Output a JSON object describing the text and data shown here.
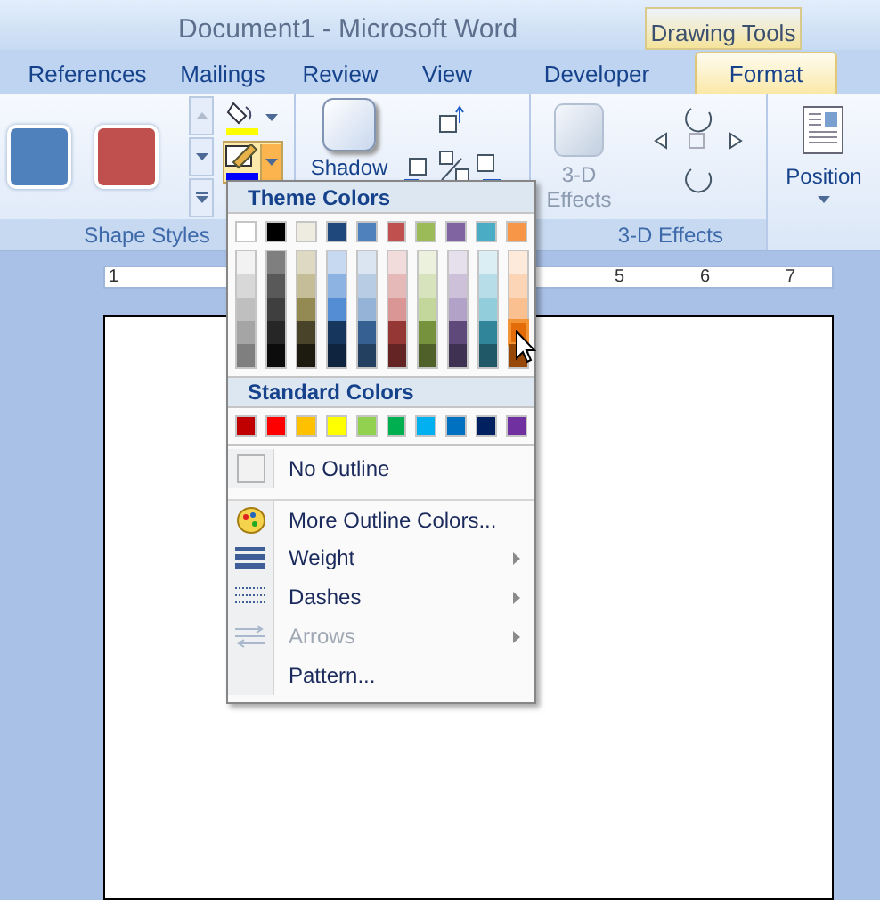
{
  "window": {
    "title": "Document1 - Microsoft Word",
    "contextual_tab": "Drawing Tools"
  },
  "tabs": [
    {
      "label": "References",
      "selected": false
    },
    {
      "label": "Mailings",
      "selected": false
    },
    {
      "label": "Review",
      "selected": false
    },
    {
      "label": "View",
      "selected": false
    },
    {
      "label": "Developer",
      "selected": false
    },
    {
      "label": "Format",
      "selected": true
    }
  ],
  "ribbon": {
    "shape_styles": {
      "label": "Shape Styles",
      "swatches": [
        {
          "color": "#4f81bd"
        },
        {
          "color": "#c0504d"
        }
      ]
    },
    "shadow": {
      "button": "Shadow"
    },
    "three_d": {
      "button": "3-D Effects",
      "label": "3-D Effects"
    },
    "position": {
      "button": "Position"
    }
  },
  "ruler": {
    "numbers": [
      "1",
      "5",
      "6",
      "7"
    ]
  },
  "outline_menu": {
    "theme_title": "Theme Colors",
    "theme_colors": [
      {
        "color": "#ffffff",
        "selected": false,
        "shades": [
          {
            "color": "#f2f2f2",
            "selected": false
          },
          {
            "color": "#d8d8d8",
            "selected": false
          },
          {
            "color": "#bfbfbf",
            "selected": false
          },
          {
            "color": "#a5a5a5",
            "selected": false
          },
          {
            "color": "#7f7f7f",
            "selected": false
          }
        ]
      },
      {
        "color": "#000000",
        "selected": false,
        "shades": [
          {
            "color": "#7f7f7f",
            "selected": false
          },
          {
            "color": "#595959",
            "selected": false
          },
          {
            "color": "#3f3f3f",
            "selected": false
          },
          {
            "color": "#262626",
            "selected": false
          },
          {
            "color": "#0c0c0c",
            "selected": false
          }
        ]
      },
      {
        "color": "#eeece1",
        "selected": false,
        "shades": [
          {
            "color": "#ddd9c3",
            "selected": false
          },
          {
            "color": "#c4bd97",
            "selected": false
          },
          {
            "color": "#938953",
            "selected": false
          },
          {
            "color": "#494429",
            "selected": false
          },
          {
            "color": "#1d1b10",
            "selected": false
          }
        ]
      },
      {
        "color": "#1f497d",
        "selected": false,
        "shades": [
          {
            "color": "#c6d9f0",
            "selected": false
          },
          {
            "color": "#8db3e2",
            "selected": false
          },
          {
            "color": "#548dd4",
            "selected": false
          },
          {
            "color": "#17365d",
            "selected": false
          },
          {
            "color": "#0f243e",
            "selected": false
          }
        ]
      },
      {
        "color": "#4f81bd",
        "selected": false,
        "shades": [
          {
            "color": "#dbe5f1",
            "selected": false
          },
          {
            "color": "#b8cce4",
            "selected": false
          },
          {
            "color": "#95b3d7",
            "selected": false
          },
          {
            "color": "#366092",
            "selected": false
          },
          {
            "color": "#244061",
            "selected": false
          }
        ]
      },
      {
        "color": "#c0504d",
        "selected": false,
        "shades": [
          {
            "color": "#f2dcdb",
            "selected": false
          },
          {
            "color": "#e5b9b7",
            "selected": false
          },
          {
            "color": "#d99694",
            "selected": false
          },
          {
            "color": "#953734",
            "selected": false
          },
          {
            "color": "#632423",
            "selected": false
          }
        ]
      },
      {
        "color": "#9bbb59",
        "selected": false,
        "shades": [
          {
            "color": "#ebf1dd",
            "selected": false
          },
          {
            "color": "#d7e3bc",
            "selected": false
          },
          {
            "color": "#c3d69b",
            "selected": false
          },
          {
            "color": "#76923c",
            "selected": false
          },
          {
            "color": "#4f6128",
            "selected": false
          }
        ]
      },
      {
        "color": "#8064a2",
        "selected": false,
        "shades": [
          {
            "color": "#e5e0ec",
            "selected": false
          },
          {
            "color": "#ccc1d9",
            "selected": false
          },
          {
            "color": "#b2a2c7",
            "selected": false
          },
          {
            "color": "#5f497a",
            "selected": false
          },
          {
            "color": "#3f3151",
            "selected": false
          }
        ]
      },
      {
        "color": "#4bacc6",
        "selected": false,
        "shades": [
          {
            "color": "#dbeef3",
            "selected": false
          },
          {
            "color": "#b7dde8",
            "selected": false
          },
          {
            "color": "#92cddc",
            "selected": false
          },
          {
            "color": "#31859b",
            "selected": false
          },
          {
            "color": "#205867",
            "selected": false
          }
        ]
      },
      {
        "color": "#f79646",
        "selected": false,
        "shades": [
          {
            "color": "#fdeada",
            "selected": false
          },
          {
            "color": "#fbd5b5",
            "selected": false
          },
          {
            "color": "#fac08f",
            "selected": false
          },
          {
            "color": "#e36c09",
            "selected": true
          },
          {
            "color": "#974806",
            "selected": false
          }
        ]
      }
    ],
    "standard_title": "Standard Colors",
    "standard_colors": [
      {
        "color": "#c00000",
        "selected": false
      },
      {
        "color": "#ff0000",
        "selected": false
      },
      {
        "color": "#ffc000",
        "selected": false
      },
      {
        "color": "#ffff00",
        "selected": false
      },
      {
        "color": "#92d050",
        "selected": false
      },
      {
        "color": "#00b050",
        "selected": false
      },
      {
        "color": "#00b0f0",
        "selected": false
      },
      {
        "color": "#0070c0",
        "selected": false
      },
      {
        "color": "#002060",
        "selected": false
      },
      {
        "color": "#7030a0",
        "selected": false
      }
    ],
    "items": [
      {
        "kind": "none",
        "label": "No Outline",
        "disabled": false,
        "submenu": false
      },
      {
        "kind": "palette",
        "label": "More Outline Colors...",
        "disabled": false,
        "submenu": false
      },
      {
        "kind": "weight",
        "label": "Weight",
        "disabled": false,
        "submenu": true
      },
      {
        "kind": "dashes",
        "label": "Dashes",
        "disabled": false,
        "submenu": true
      },
      {
        "kind": "arrows",
        "label": "Arrows",
        "disabled": true,
        "submenu": true
      },
      {
        "kind": "pattern",
        "label": "Pattern...",
        "disabled": false,
        "submenu": false
      }
    ]
  }
}
